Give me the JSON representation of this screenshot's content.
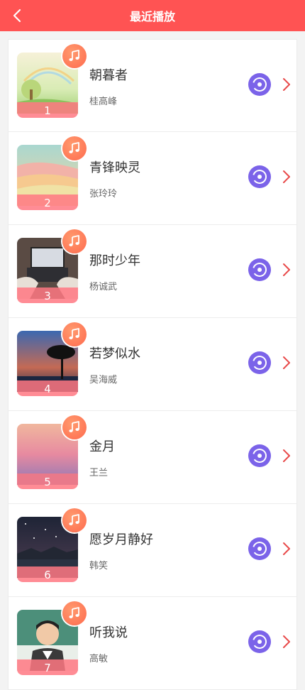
{
  "header": {
    "title": "最近播放"
  },
  "icons": {
    "back": "chevron-left-icon",
    "note": "music-note-icon",
    "disc": "disc-icon",
    "go": "chevron-right-icon"
  },
  "colors": {
    "header_bg": "#ff5353",
    "disc_bg": "#7b63e9",
    "chevron": "#e84b4b",
    "badge": "#ff7a55"
  },
  "songs": [
    {
      "rank": "1",
      "title": "朝暮者",
      "artist": "桂高峰",
      "art": "meadow"
    },
    {
      "rank": "2",
      "title": "青锋映灵",
      "artist": "张玲玲",
      "art": "pastel"
    },
    {
      "rank": "3",
      "title": "那时少年",
      "artist": "杨诚武",
      "art": "laptop"
    },
    {
      "rank": "4",
      "title": "若梦似水",
      "artist": "吴海威",
      "art": "tree"
    },
    {
      "rank": "5",
      "title": "金月",
      "artist": "王兰",
      "art": "pink-sea"
    },
    {
      "rank": "6",
      "title": "愿岁月静好",
      "artist": "韩笑",
      "art": "night"
    },
    {
      "rank": "7",
      "title": "听我说",
      "artist": "高敏",
      "art": "boy"
    }
  ]
}
